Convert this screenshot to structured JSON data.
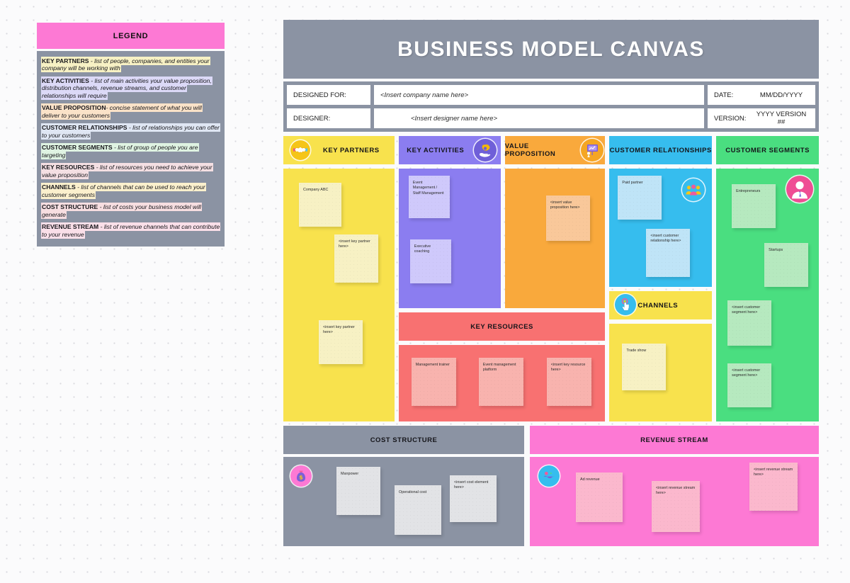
{
  "legend": {
    "title": "LEGEND",
    "entries": [
      {
        "term": "KEY PARTNERS",
        "desc": " - list of people, companies, and entities your company will be working with",
        "highlight": "#f7f1c4"
      },
      {
        "term": "KEY ACTIVITIES",
        "desc": " - list of main activities your value proposition, distribution channels, revenue streams, and customer relationships will require",
        "highlight": "#dcd9f7"
      },
      {
        "term": "VALUE PROPOSITION",
        "desc": "- concise statement of what you will deliver to your customers",
        "highlight": "#fae2c8"
      },
      {
        "term": "CUSTOMER RELATIONSHIPS",
        "desc": " - list of relationships you can offer to your customers",
        "highlight": "#dfe6f3"
      },
      {
        "term": "CUSTOMER SEGMENTS",
        "desc": " - list of group of people you are targeting",
        "highlight": "#dff3e2"
      },
      {
        "term": "KEY RESOURCES",
        "desc": " - list of resources you need to achieve your value proposition",
        "highlight": "#f4dfe3"
      },
      {
        "term": "CHANNELS",
        "desc": " - list of channels that can be used to reach your customer segments",
        "highlight": "#fbf0cd"
      },
      {
        "term": "COST STRUCTURE",
        "desc": " - list of costs your business model will generate",
        "highlight": "#f7dee1"
      },
      {
        "term": "REVENUE STREAM",
        "desc": " - list of revenue channels that can contribute to your revenue",
        "highlight": "#fadfe9"
      }
    ]
  },
  "canvas": {
    "title": "BUSINESS MODEL CANVAS",
    "meta": {
      "designed_for_label": "DESIGNED FOR:",
      "designed_for_value": "<Insert company name here>",
      "date_label": "DATE:",
      "date_value": "MM/DD/YYYY",
      "designer_label": "DESIGNER:",
      "designer_value": "<Insert designer name here>",
      "version_label": "VERSION:",
      "version_value": "YYYY VERSION ##"
    },
    "blocks": {
      "key_partners": {
        "title": "KEY PARTNERS",
        "color": "#f8e24d",
        "icon": "handshake-icon",
        "notes": [
          {
            "text": "Company ABC"
          },
          {
            "text": "<insert key partner here>"
          },
          {
            "text": "<insert key partner here>"
          }
        ]
      },
      "key_activities": {
        "title": "KEY ACTIVITIES",
        "color": "#8b7df0",
        "icon": "gear-hand-icon",
        "notes": [
          {
            "text": "Event Management / Staff Management"
          },
          {
            "text": "Executive coaching"
          }
        ]
      },
      "value_proposition": {
        "title": "VALUE PROPOSITION",
        "color": "#f9a93c",
        "icon": "presentation-chart-icon",
        "notes": [
          {
            "text": "<insert value proposition here>"
          }
        ]
      },
      "customer_relationships": {
        "title": "CUSTOMER RELATIONSHIPS",
        "color": "#36bdee",
        "icon": "people-group-icon",
        "notes": [
          {
            "text": "Paid partner"
          },
          {
            "text": "<insert customer relationship here>"
          }
        ]
      },
      "customer_segments": {
        "title": "CUSTOMER SEGMENTS",
        "color": "#4ade80",
        "icon": "businessperson-avatar-icon",
        "notes": [
          {
            "text": "Entrepreneurs"
          },
          {
            "text": "Startups"
          },
          {
            "text": "<insert customer segment here>"
          },
          {
            "text": "<insert customer segment here>"
          }
        ]
      },
      "key_resources": {
        "title": "KEY RESOURCES",
        "color": "#f87171",
        "notes": [
          {
            "text": "Management trainer"
          },
          {
            "text": "Event management platform"
          },
          {
            "text": "<insert key resource here>"
          }
        ]
      },
      "channels": {
        "title": "CHANNELS",
        "color": "#f8e24d",
        "icon": "touch-click-icon",
        "notes": [
          {
            "text": "Trade show"
          }
        ]
      },
      "cost_structure": {
        "title": "COST STRUCTURE",
        "color": "#8b93a3",
        "icon": "money-bag-icon",
        "notes": [
          {
            "text": "Manpower"
          },
          {
            "text": "Operational cost"
          },
          {
            "text": "<insert cost element here>"
          }
        ]
      },
      "revenue_stream": {
        "title": "REVENUE STREAM",
        "color": "#fd79d4",
        "icon": "globe-money-icon",
        "notes": [
          {
            "text": "Ad revenue"
          },
          {
            "text": "<insert revenue stream here>"
          },
          {
            "text": "<insert revenue stream here>"
          }
        ]
      }
    }
  }
}
